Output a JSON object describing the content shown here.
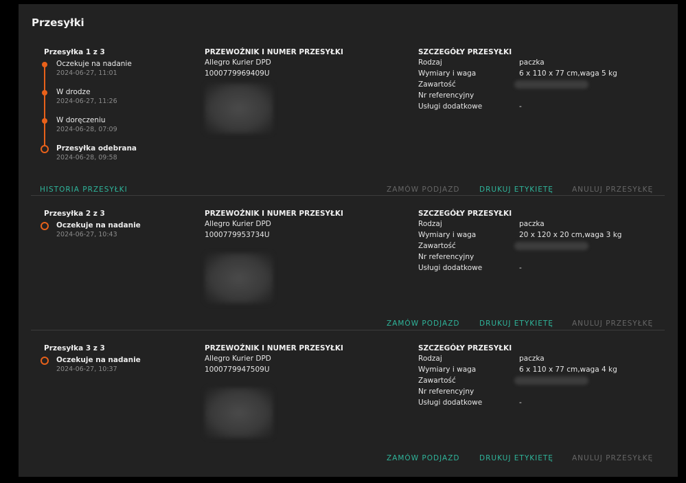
{
  "panel_title": "Przesyłki",
  "labels": {
    "carrier_header": "PRZEWOŹNIK I NUMER PRZESYŁKI",
    "details_header": "SZCZEGÓŁY PRZESYŁKI",
    "type": "Rodzaj",
    "dimensions": "Wymiary i waga",
    "content": "Zawartość",
    "reference": "Nr referencyjny",
    "services": "Usługi dodatkowe"
  },
  "actions": {
    "history": "HISTORIA PRZESYŁKI",
    "order_pickup": "ZAMÓW PODJAZD",
    "print_label": "DRUKUJ ETYKIETĘ",
    "cancel": "ANULUJ PRZESYŁKĘ"
  },
  "shipments": [
    {
      "number": "Przesyłka 1 z 3",
      "timeline": [
        {
          "label": "Oczekuje na nadanie",
          "time": "2024-06-27, 11:01"
        },
        {
          "label": "W drodze",
          "time": "2024-06-27, 11:26"
        },
        {
          "label": "W doręczeniu",
          "time": "2024-06-28, 07:09"
        },
        {
          "label": "Przesyłka odebrana",
          "time": "2024-06-28, 09:58"
        }
      ],
      "carrier": "Allegro Kurier DPD",
      "tracking": "1000779969409U",
      "type": "paczka",
      "dimensions": "6 x 110 x 77 cm,waga 5 kg",
      "services": "-",
      "order_pickup_enabled": false
    },
    {
      "number": "Przesyłka 2 z 3",
      "timeline": [
        {
          "label": "Oczekuje na nadanie",
          "time": "2024-06-27, 10:43"
        }
      ],
      "carrier": "Allegro Kurier DPD",
      "tracking": "1000779953734U",
      "type": "paczka",
      "dimensions": "20 x 120 x 20 cm,waga 3 kg",
      "services": "-",
      "order_pickup_enabled": true
    },
    {
      "number": "Przesyłka 3 z 3",
      "timeline": [
        {
          "label": "Oczekuje na nadanie",
          "time": "2024-06-27, 10:37"
        }
      ],
      "carrier": "Allegro Kurier DPD",
      "tracking": "1000779947509U",
      "type": "paczka",
      "dimensions": "6 x 110 x 77 cm,waga 4 kg",
      "services": "-",
      "order_pickup_enabled": true
    }
  ],
  "colors": {
    "accent_orange": "#e8611a",
    "action_teal": "#2fb59b",
    "action_disabled": "#666666",
    "panel_bg": "#222222"
  }
}
